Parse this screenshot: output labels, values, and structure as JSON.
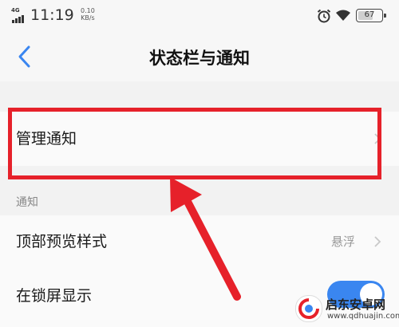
{
  "status_bar": {
    "network_label": "4G",
    "time": "11:19",
    "speed_value": "0.10",
    "speed_unit": "KB/s",
    "battery_level": "67",
    "icons": [
      "signal-icon",
      "alarm-icon",
      "wifi-icon",
      "battery-icon"
    ]
  },
  "header": {
    "back_icon": "chevron-left-icon",
    "title": "状态栏与通知"
  },
  "manage_notifications": {
    "label": "管理通知",
    "chevron_icon": "chevron-right-icon"
  },
  "notifications_section": {
    "header": "通知",
    "items": [
      {
        "label": "顶部预览样式",
        "value": "悬浮",
        "control": "chevron-right-icon"
      },
      {
        "label": "在锁屏显示",
        "control": "toggle",
        "toggle_on": true
      }
    ]
  },
  "annotation": {
    "highlight_color": "#e6212a"
  },
  "watermark": {
    "title": "启东安卓网",
    "url": "www.qdhuajin.com"
  },
  "colors": {
    "accent": "#3a86f0",
    "background": "#f2f2f2",
    "highlight": "#e6212a"
  }
}
